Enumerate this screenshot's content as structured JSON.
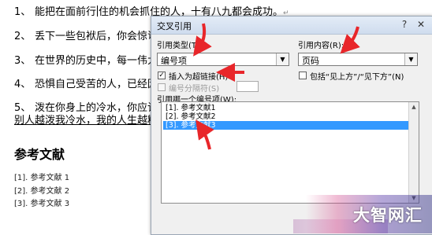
{
  "document": {
    "paragraphs": [
      {
        "num": "1、",
        "text_before": "能把在面前行",
        "text_after": "住的机会抓住的人，十有八九都会成功。"
      },
      {
        "num": "2、",
        "text": "丢下一些包袱后，你会惊讶"
      },
      {
        "num": "3、",
        "text": "在世界的历史中，每一伟大"
      },
      {
        "num": "4、",
        "text": "恐惧自己受苦的人，已经因"
      },
      {
        "num": "5、",
        "text": "泼在你身上的冷水，你应该"
      }
    ],
    "para5_line2": "别人越泼我冷水，我的人生越精",
    "para_mark": "↵",
    "ref_heading": "参考文献",
    "ref_items": [
      "[1]. 参考文献 1",
      "[2]. 参考文献 2",
      "[3]. 参考文献 3"
    ]
  },
  "dialog": {
    "title": "交叉引用",
    "help": "?",
    "close": "✕",
    "ref_type_label": "引用类型(T):",
    "ref_type_value": "编号项",
    "ref_content_label": "引用内容(R):",
    "ref_content_value": "页码",
    "insert_hyperlink_label": "插入为超链接(H)",
    "insert_hyperlink_checked": true,
    "separate_numbers_label": "编号分隔符(S)",
    "include_above_below_label": "包括“见上方”/“见下方”(N)",
    "which_item_label": "引用哪一个编号项(W):",
    "items": [
      "[1]. 参考文献1",
      "[2]. 参考文献2",
      "[3]. 参考文献3"
    ],
    "selected_index": 2,
    "highlight_color": "#3399ff",
    "arrow_color": "#e8262a"
  },
  "watermark": {
    "text": "大智网汇"
  }
}
